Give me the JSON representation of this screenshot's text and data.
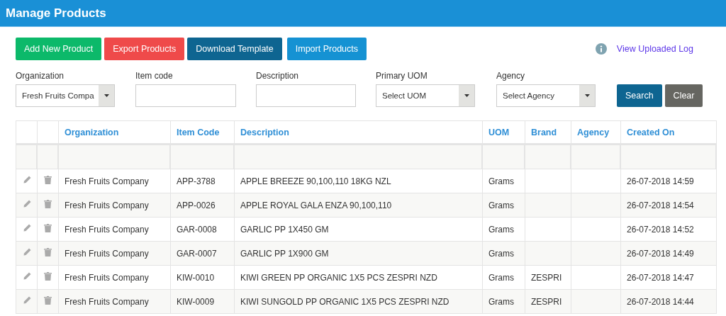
{
  "window": {
    "title": "Manage Products"
  },
  "actions": [
    {
      "label": "Add New Product",
      "kind": "success"
    },
    {
      "label": "Export Products",
      "kind": "danger"
    },
    {
      "label": "Download Template",
      "kind": "dark"
    },
    {
      "label": "Import Products",
      "kind": "info"
    }
  ],
  "log_link": {
    "label": "View Uploaded Log"
  },
  "filters": [
    {
      "label": "Organization",
      "kind": "select",
      "value": "Fresh Fruits Compa"
    },
    {
      "label": "Item code",
      "kind": "text"
    },
    {
      "label": "Description",
      "kind": "text"
    },
    {
      "label": "Primary UOM",
      "kind": "select",
      "placeholder": "Select UOM"
    },
    {
      "label": "Agency",
      "kind": "select",
      "placeholder": "Select Agency"
    }
  ],
  "filter_buttons": [
    {
      "label": "Search",
      "kind": "primary"
    },
    {
      "label": "Clear",
      "kind": "secondary"
    }
  ],
  "table": {
    "columns": [
      "Organization",
      "Item Code",
      "Description",
      "UOM",
      "Brand",
      "Agency",
      "Created On"
    ],
    "rows": [
      {
        "organization": "Fresh Fruits Company",
        "item_code": "APP-3788",
        "description": "APPLE BREEZE 90,100,110 18KG NZL",
        "uom": "Grams",
        "created_on": "26-07-2018 14:59"
      },
      {
        "organization": "Fresh Fruits Company",
        "item_code": "APP-0026",
        "description": "APPLE ROYAL GALA ENZA 90,100,110",
        "uom": "Grams",
        "created_on": "26-07-2018 14:54"
      },
      {
        "organization": "Fresh Fruits Company",
        "item_code": "GAR-0008",
        "description": "GARLIC PP 1X450 GM",
        "uom": "Grams",
        "created_on": "26-07-2018 14:52"
      },
      {
        "organization": "Fresh Fruits Company",
        "item_code": "GAR-0007",
        "description": "GARLIC PP 1X900 GM",
        "uom": "Grams",
        "created_on": "26-07-2018 14:49"
      },
      {
        "organization": "Fresh Fruits Company",
        "item_code": "KIW-0010",
        "description": "KIWI GREEN PP ORGANIC 1X5 PCS ZESPRI NZD",
        "uom": "Grams",
        "brand": "ZESPRI",
        "created_on": "26-07-2018 14:47"
      },
      {
        "organization": "Fresh Fruits Company",
        "item_code": "KIW-0009",
        "description": "KIWI SUNGOLD PP ORGANIC 1X5 PCS ZESPRI NZD",
        "uom": "Grams",
        "brand": "ZESPRI",
        "created_on": "26-07-2018 14:44"
      }
    ]
  }
}
